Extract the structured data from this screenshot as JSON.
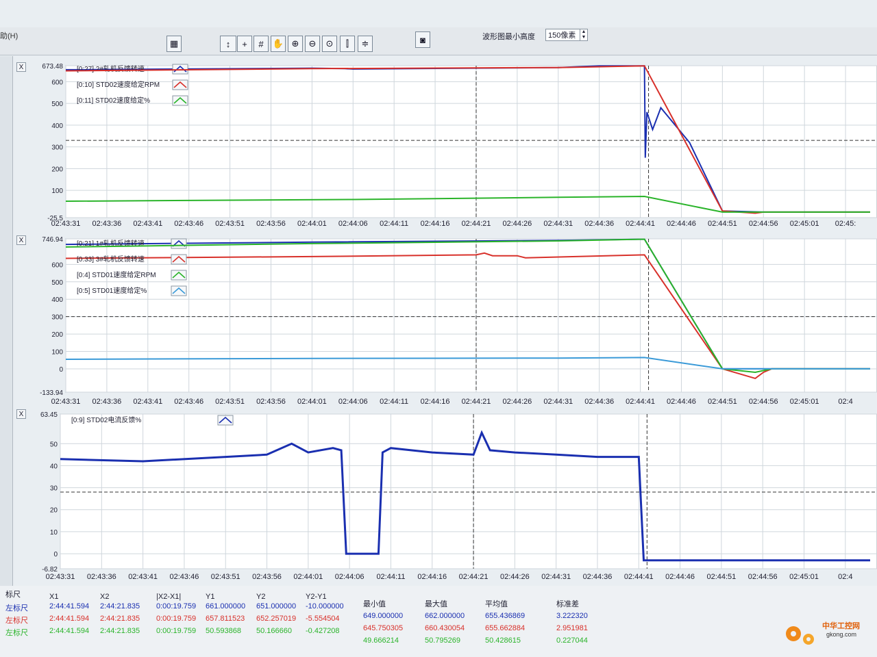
{
  "toolbar": {
    "menu_help": "助(H)",
    "min_height_label": "波形图最小高度",
    "min_height_value": "150像素",
    "buttons": [
      "grid-toggle",
      "y-axis-adjust",
      "crosshair",
      "grid-lines",
      "pan-hand",
      "zoom-in",
      "zoom-out",
      "zoom-fit",
      "x-cursor",
      "y-cursor",
      "screenshot"
    ]
  },
  "colors": {
    "blue": "#1a2fb0",
    "red": "#d8302a",
    "green": "#2ab42a",
    "lightblue": "#3a9ad8",
    "grid": "#cfd6dc"
  },
  "chart_data": [
    {
      "type": "line",
      "ylim": [
        -25.5,
        673.48
      ],
      "ytick_labels": [
        "673.48",
        "600",
        "500",
        "400",
        "300",
        "200",
        "100",
        "-25.5"
      ],
      "yticks": [
        673.48,
        600,
        500,
        400,
        300,
        200,
        100,
        -25.5
      ],
      "xtick_labels": [
        "02:43:31",
        "02:43:36",
        "02:43:41",
        "02:43:46",
        "02:43:51",
        "02:43:56",
        "02:44:01",
        "02:44:06",
        "02:44:11",
        "02:44:16",
        "02:44:21",
        "02:44:26",
        "02:44:31",
        "02:44:36",
        "02:44:41",
        "02:44:46",
        "02:44:51",
        "02:44:56",
        "02:45:01",
        "02:45:"
      ],
      "xlim": [
        0,
        98
      ],
      "cursor_x": [
        50,
        71
      ],
      "cursor_y": 330,
      "series": [
        {
          "name": "[0:27] 2#轧机反馈转速",
          "color": "#1a2fb0",
          "x": [
            0,
            30,
            34,
            35,
            60,
            65,
            70.5,
            70.6,
            70.8,
            71.5,
            72.5,
            76,
            80,
            85,
            98
          ],
          "y": [
            655,
            662,
            660,
            658,
            665,
            673,
            673,
            250,
            460,
            380,
            480,
            320,
            5,
            0,
            0
          ]
        },
        {
          "name": "[0:10] STD02速度给定RPM",
          "color": "#d8302a",
          "x": [
            0,
            30,
            60,
            70.5,
            80,
            84,
            85,
            88,
            98
          ],
          "y": [
            650,
            660,
            665,
            673,
            5,
            -5,
            0,
            0,
            0
          ]
        },
        {
          "name": "[0:11] STD02速度给定%",
          "color": "#2ab42a",
          "x": [
            0,
            35,
            60,
            70.5,
            80,
            98
          ],
          "y": [
            50,
            58,
            68,
            72,
            0,
            0
          ]
        }
      ]
    },
    {
      "type": "line",
      "ylim": [
        -133.94,
        746.94
      ],
      "ytick_labels": [
        "746.94",
        "600",
        "500",
        "400",
        "300",
        "200",
        "100",
        "0",
        "-133.94"
      ],
      "yticks": [
        746.94,
        600,
        500,
        400,
        300,
        200,
        100,
        0,
        -133.94
      ],
      "xtick_labels": [
        "02:43:31",
        "02:43:36",
        "02:43:41",
        "02:43:46",
        "02:43:51",
        "02:43:56",
        "02:44:01",
        "02:44:06",
        "02:44:11",
        "02:44:16",
        "02:44:21",
        "02:44:26",
        "02:44:31",
        "02:44:36",
        "02:44:41",
        "02:44:46",
        "02:44:51",
        "02:44:56",
        "02:45:01",
        "02:4"
      ],
      "xlim": [
        0,
        98
      ],
      "cursor_x": [
        50,
        71
      ],
      "cursor_y": 300,
      "series": [
        {
          "name": "[0:21] 1#轧机反馈转速",
          "color": "#1a2fb0",
          "x": [
            0,
            30,
            60,
            70.5,
            80,
            98
          ],
          "y": [
            715,
            728,
            738,
            745,
            0,
            0
          ]
        },
        {
          "name": "[0:33] 3#轧机反馈转速",
          "color": "#d8302a",
          "x": [
            0,
            30,
            50,
            51,
            52,
            55,
            56,
            70.5,
            80,
            84,
            85,
            86,
            98
          ],
          "y": [
            635,
            645,
            655,
            665,
            650,
            650,
            638,
            655,
            0,
            -55,
            -20,
            0,
            0
          ]
        },
        {
          "name": "[0:4] STD01速度给定RPM",
          "color": "#2ab42a",
          "x": [
            0,
            30,
            60,
            70.5,
            80,
            84,
            86,
            98
          ],
          "y": [
            700,
            720,
            735,
            745,
            0,
            -20,
            0,
            0
          ]
        },
        {
          "name": "[0:5] STD01速度给定%",
          "color": "#3a9ad8",
          "x": [
            0,
            30,
            60,
            70.5,
            80,
            98
          ],
          "y": [
            55,
            60,
            62,
            65,
            0,
            0
          ]
        }
      ]
    },
    {
      "type": "line",
      "ylim": [
        -6.82,
        63.45
      ],
      "ytick_labels": [
        "63.45",
        "50",
        "40",
        "30",
        "20",
        "10",
        "0",
        "-6.82"
      ],
      "yticks": [
        63.45,
        50,
        40,
        30,
        20,
        10,
        0,
        -6.82
      ],
      "xtick_labels": [
        "02:43:31",
        "02:43:36",
        "02:43:41",
        "02:43:46",
        "02:43:51",
        "02:43:56",
        "02:44:01",
        "02:44:06",
        "02:44:11",
        "02:44:16",
        "02:44:21",
        "02:44:26",
        "02:44:31",
        "02:44:36",
        "02:44:41",
        "02:44:46",
        "02:44:51",
        "02:44:56",
        "02:45:01",
        "02:4"
      ],
      "xlim": [
        0,
        98
      ],
      "cursor_x": [
        50,
        71
      ],
      "cursor_y": 28,
      "series": [
        {
          "name": "[0:9] STD02电流反馈%",
          "color": "#1a2fb0",
          "x": [
            0,
            10,
            20,
            25,
            28,
            30,
            33,
            34,
            34.6,
            35,
            38.5,
            39,
            40,
            45,
            50,
            51,
            52,
            55,
            60,
            65,
            70,
            70.6,
            71,
            98
          ],
          "y": [
            43,
            42,
            44,
            45,
            50,
            46,
            48,
            47,
            0,
            0,
            0,
            46,
            48,
            46,
            45,
            55,
            47,
            46,
            45,
            44,
            44,
            -3,
            -3,
            -3
          ]
        }
      ]
    }
  ],
  "cursor_table": {
    "headers": [
      "标尺",
      "X1",
      "X2",
      "|X2-X1|",
      "Y1",
      "Y2",
      "Y2-Y1",
      "最小值",
      "最大值",
      "平均值",
      "标准差"
    ],
    "rows": [
      {
        "label": "左标尺",
        "x1": "2:44:41.594",
        "x2": "2:44:21.835",
        "dx": "0:00:19.759",
        "y1": "661.000000",
        "y2": "651.000000",
        "dy": "-10.000000",
        "min": "649.000000",
        "max": "662.000000",
        "avg": "655.436869",
        "std": "3.222320",
        "color": "#1a2fb0"
      },
      {
        "label": "左标尺",
        "x1": "2:44:41.594",
        "x2": "2:44:21.835",
        "dx": "0:00:19.759",
        "y1": "657.811523",
        "y2": "652.257019",
        "dy": "-5.554504",
        "min": "645.750305",
        "max": "660.430054",
        "avg": "655.662884",
        "std": "2.951981",
        "color": "#d8302a"
      },
      {
        "label": "左标尺",
        "x1": "2:44:41.594",
        "x2": "2:44:21.835",
        "dx": "0:00:19.759",
        "y1": "50.593868",
        "y2": "50.166660",
        "dy": "-0.427208",
        "min": "49.666214",
        "max": "50.795269",
        "avg": "50.428615",
        "std": "0.227044",
        "color": "#2ab42a"
      }
    ]
  },
  "watermark": {
    "text": "中华工控网",
    "sub": "gkong.com"
  }
}
